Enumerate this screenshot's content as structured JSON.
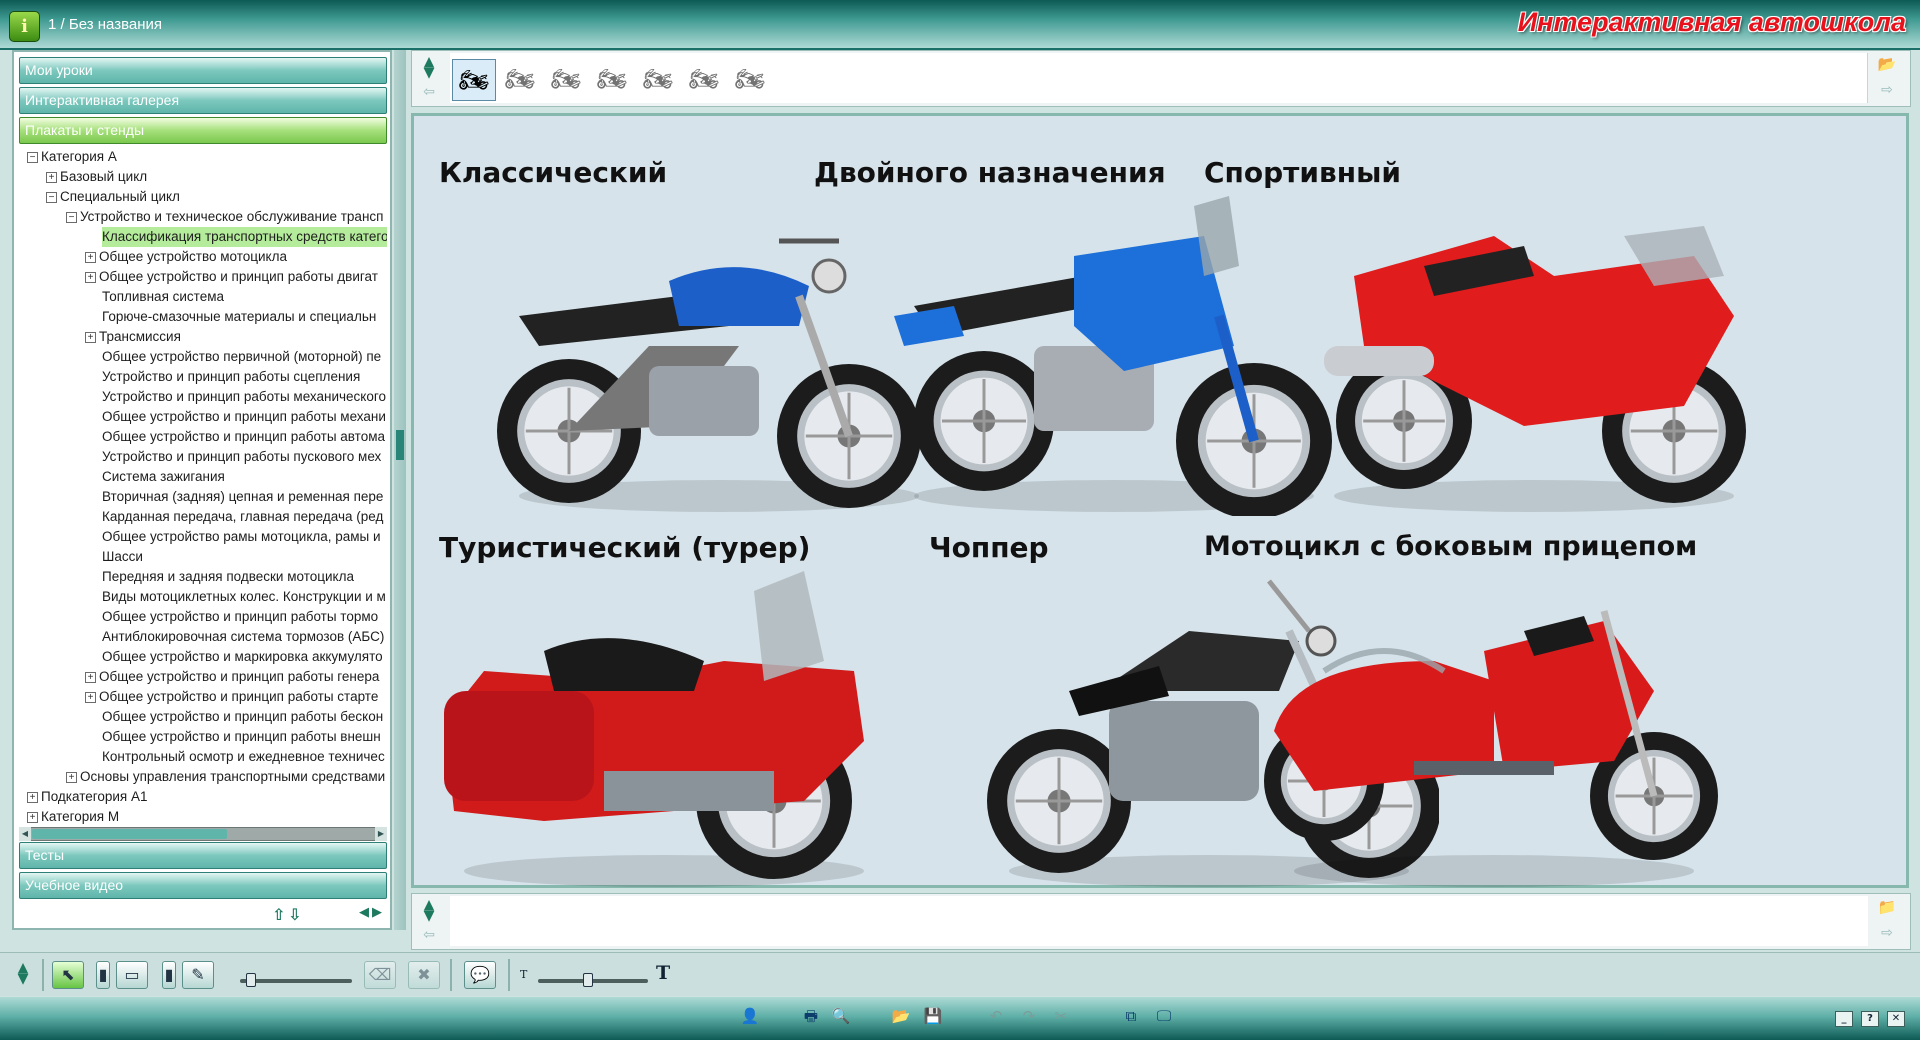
{
  "window": {
    "title": "1 / Без названия",
    "brand": "Интерактивная автошкола"
  },
  "sidebar": {
    "sections_top": [
      {
        "label": "Мои уроки",
        "active": false
      },
      {
        "label": "Интерактивная галерея",
        "active": false
      },
      {
        "label": "Плакаты и стенды",
        "active": true
      }
    ],
    "sections_bottom": [
      {
        "label": "Тесты"
      },
      {
        "label": "Учебное видео"
      }
    ],
    "tree": [
      {
        "level": 0,
        "exp": "−",
        "label": "Категория А"
      },
      {
        "level": 1,
        "exp": "+",
        "label": "Базовый цикл"
      },
      {
        "level": 1,
        "exp": "−",
        "label": "Специальный цикл"
      },
      {
        "level": 2,
        "exp": "−",
        "label": "Устройство и техническое обслуживание трансп"
      },
      {
        "level": 3,
        "exp": "",
        "label": "Классификация транспортных средств катего",
        "selected": true
      },
      {
        "level": 3,
        "exp": "+",
        "label": "Общее устройство мотоцикла"
      },
      {
        "level": 3,
        "exp": "+",
        "label": "Общее устройство и принцип работы двигат"
      },
      {
        "level": 3,
        "exp": "",
        "label": "Топливная система"
      },
      {
        "level": 3,
        "exp": "",
        "label": "Горюче-смазочные материалы и специальн"
      },
      {
        "level": 3,
        "exp": "+",
        "label": "Трансмиссия"
      },
      {
        "level": 3,
        "exp": "",
        "label": "Общее устройство первичной (моторной) пе"
      },
      {
        "level": 3,
        "exp": "",
        "label": "Устройство и принцип работы сцепления"
      },
      {
        "level": 3,
        "exp": "",
        "label": "Устройство и принцип работы механического"
      },
      {
        "level": 3,
        "exp": "",
        "label": "Общее устройство и принцип работы механи"
      },
      {
        "level": 3,
        "exp": "",
        "label": "Общее устройство и принцип работы автома"
      },
      {
        "level": 3,
        "exp": "",
        "label": "Устройство и принцип работы пускового мех"
      },
      {
        "level": 3,
        "exp": "",
        "label": "Система зажигания"
      },
      {
        "level": 3,
        "exp": "",
        "label": "Вторичная (задняя) цепная и ременная пере"
      },
      {
        "level": 3,
        "exp": "",
        "label": "Карданная передача, главная передача (ред"
      },
      {
        "level": 3,
        "exp": "",
        "label": "Общее устройство рамы мотоцикла, рамы и"
      },
      {
        "level": 3,
        "exp": "",
        "label": "Шасси"
      },
      {
        "level": 3,
        "exp": "",
        "label": "Передняя и задняя подвески мотоцикла"
      },
      {
        "level": 3,
        "exp": "",
        "label": "Виды мотоциклетных колес. Конструкции и м"
      },
      {
        "level": 3,
        "exp": "",
        "label": "Общее устройство и принцип работы тормо"
      },
      {
        "level": 3,
        "exp": "",
        "label": "Антиблокировочная система тормозов (АБС)"
      },
      {
        "level": 3,
        "exp": "",
        "label": "Общее устройство и маркировка аккумулято"
      },
      {
        "level": 3,
        "exp": "+",
        "label": "Общее устройство и принцип работы генера"
      },
      {
        "level": 3,
        "exp": "+",
        "label": "Общее устройство и принцип работы старте"
      },
      {
        "level": 3,
        "exp": "",
        "label": "Общее устройство и принцип работы бескон"
      },
      {
        "level": 3,
        "exp": "",
        "label": "Общее устройство и принцип работы внешн"
      },
      {
        "level": 3,
        "exp": "",
        "label": "Контрольный осмотр и ежедневное техничес"
      },
      {
        "level": 2,
        "exp": "+",
        "label": "Основы управления транспортными средствами"
      },
      {
        "level": 0,
        "exp": "+",
        "label": "Подкатегория А1"
      },
      {
        "level": 0,
        "exp": "+",
        "label": "Категория М"
      }
    ]
  },
  "thumbnails": [
    {
      "icon": "poster-thumb-all-icon",
      "selected": true
    },
    {
      "icon": "classic-thumb-icon"
    },
    {
      "icon": "dual-sport-thumb-icon"
    },
    {
      "icon": "sport-thumb-icon"
    },
    {
      "icon": "tourer-thumb-icon"
    },
    {
      "icon": "chopper-thumb-icon"
    },
    {
      "icon": "sidecar-thumb-icon"
    }
  ],
  "poster": {
    "items": [
      {
        "title": "Классический",
        "type": "classic",
        "color": "#1d5fc9"
      },
      {
        "title": "Двойного назначения",
        "type": "dual",
        "color": "#1d6fd9"
      },
      {
        "title": "Спортивный",
        "type": "sport",
        "color": "#e01c1c"
      },
      {
        "title": "Туристический (турер)",
        "type": "tourer",
        "color": "#d11a1a"
      },
      {
        "title": "Чоппер",
        "type": "chopper",
        "color": "#2a2a2a"
      },
      {
        "title": "Мотоцикл с боковым прицепом",
        "type": "sidecar",
        "color": "#d81a1a"
      }
    ]
  },
  "toolbar": {
    "text_size_small": "T",
    "text_size_large": "T",
    "line_width_value": 0.1,
    "text_size_value": 0.45
  },
  "colors": {
    "accent": "#5fb5aa",
    "brand": "#e8121c",
    "selection": "#b5ec9c"
  }
}
